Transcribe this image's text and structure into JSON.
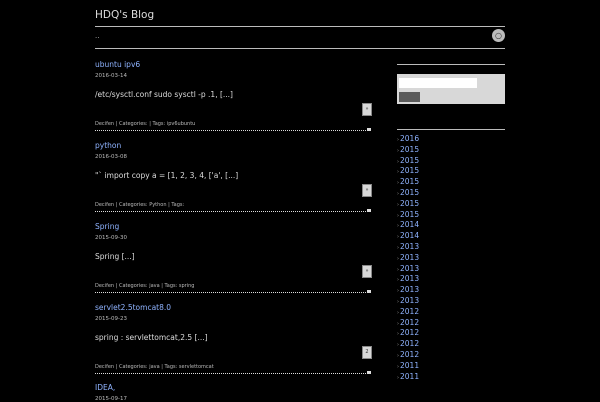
{
  "header": {
    "blog_title": "HDQ's Blog",
    "nav_dots": "..",
    "rss_icon": "rss-icon"
  },
  "posts": [
    {
      "title": "ubuntu ipv6",
      "date": "2016-03-14",
      "excerpt": "/etc/sysctl.conf  sudo sysctl -p .1,  [...]",
      "more": "»",
      "author": "Decifen",
      "categories_label": "Categories:",
      "categories": "",
      "tags_label": "Tags:",
      "tags": "ipv6ubuntu"
    },
    {
      "title": "python",
      "date": "2016-03-08",
      "excerpt": "\"` import copy a = [1, 2, 3, 4, ['a', [...]",
      "more": "»",
      "author": "Decifen",
      "categories_label": "Categories:",
      "categories": "Python",
      "tags_label": "Tags:",
      "tags": ""
    },
    {
      "title": "Spring",
      "date": "2015-09-30",
      "excerpt": "Spring [...]",
      "more": "»",
      "author": "Decifen",
      "categories_label": "Categories:",
      "categories": "java",
      "tags_label": "Tags:",
      "tags": "spring"
    },
    {
      "title": "servlet2.5tomcat8.0",
      "date": "2015-09-23",
      "excerpt": "spring : servlettomcat,2.5 [...]",
      "more": "2",
      "author": "Decifen",
      "categories_label": "Categories:",
      "categories": "java",
      "tags_label": "Tags:",
      "tags": "servlettomcat"
    },
    {
      "title": "IDEA,",
      "date": "2015-09-17",
      "excerpt": "",
      "more": "",
      "author": "",
      "categories_label": "",
      "categories": "",
      "tags_label": "",
      "tags": ""
    }
  ],
  "sidebar": {
    "search": {
      "placeholder": "",
      "button_label": ""
    },
    "archive": [
      "2016",
      "2015",
      "2015",
      "2015",
      "2015",
      "2015",
      "2015",
      "2015",
      "2014",
      "2014",
      "2013",
      "2013",
      "2013",
      "2013",
      "2013",
      "2013",
      "2012",
      "2012",
      "2012",
      "2012",
      "2012",
      "2011",
      "2011"
    ]
  }
}
